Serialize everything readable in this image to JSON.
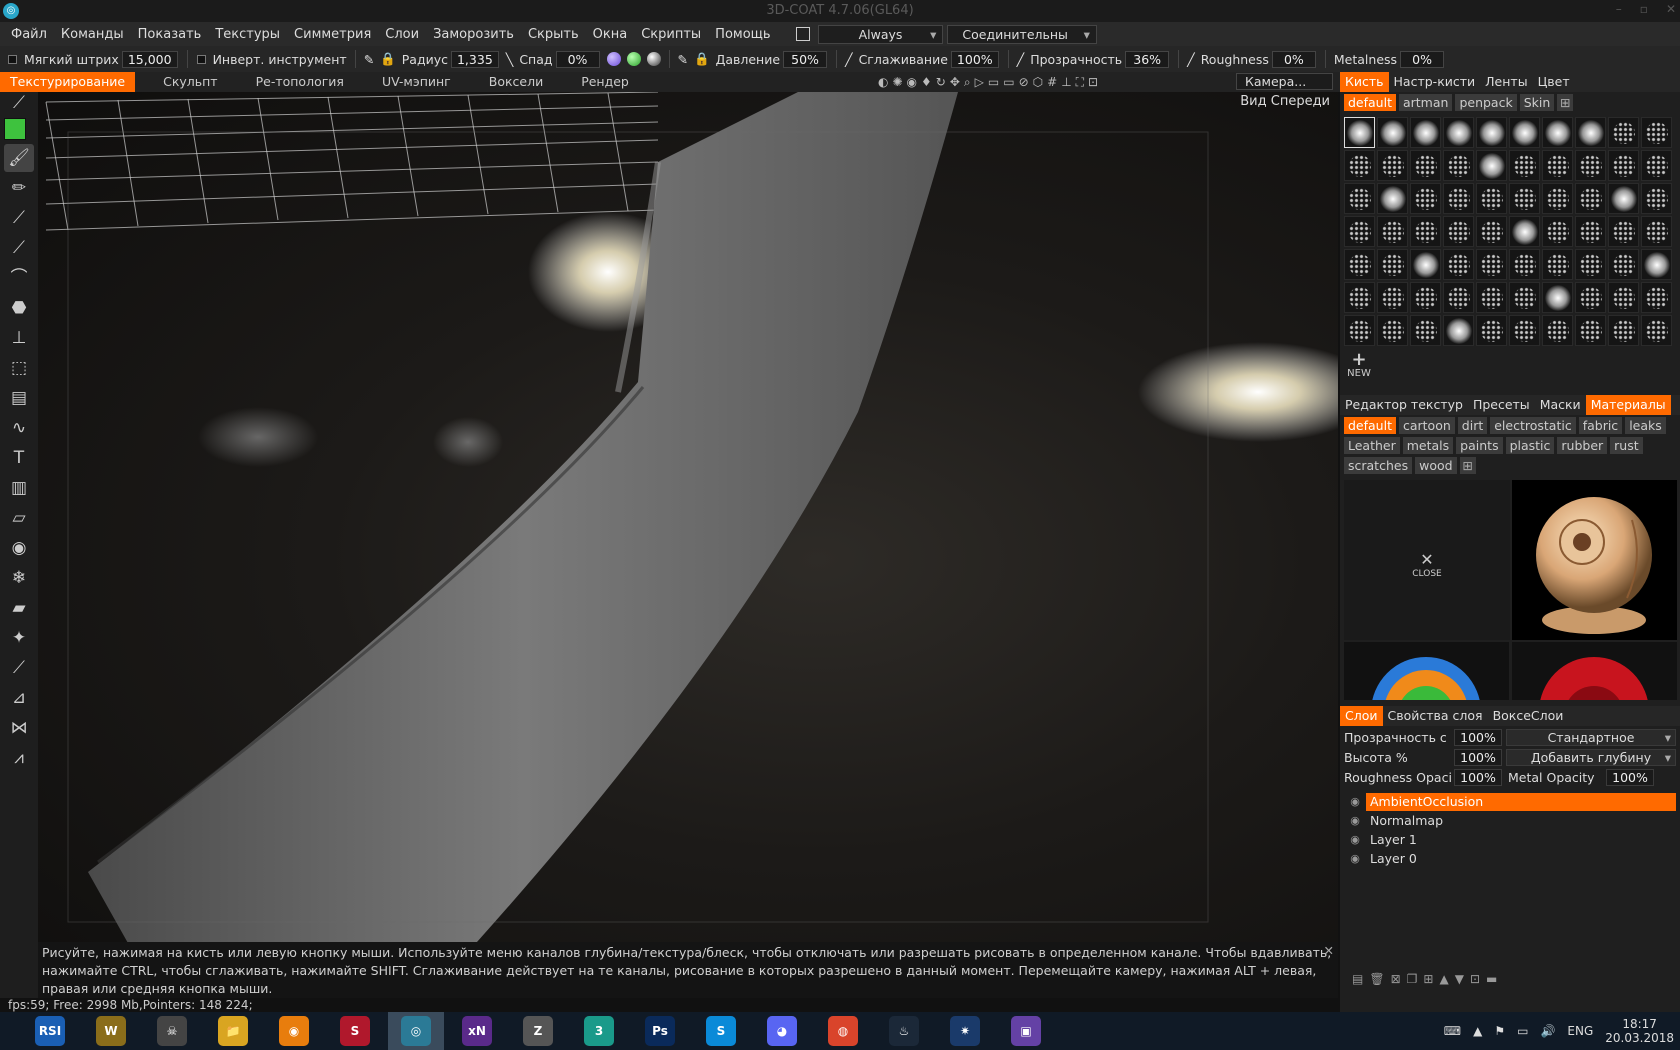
{
  "window": {
    "title": "3D-COAT 4.7.06(GL64)",
    "app_icon": "3dcoat-icon",
    "controls": [
      "–",
      "▫",
      "✕"
    ]
  },
  "menu": {
    "items": [
      "Файл",
      "Команды",
      "Показать",
      "Текстуры",
      "Симметрия",
      "Слои",
      "Заморозить",
      "Скрыть",
      "Окна",
      "Скрипты",
      "Помощь"
    ],
    "always_label": "Always",
    "connect_label": "Соединительны"
  },
  "toolbar": {
    "soft_stroke_label": "Мягкий штрих",
    "soft_stroke_value": "15,000",
    "invert_label": "Инверт. инструмент",
    "radius_label": "Радиус",
    "radius_value": "1,335",
    "falloff_label": "Спад",
    "falloff_value": "0%",
    "pressure_label": "Давление",
    "pressure_value": "50%",
    "smoothing_label": "Сглаживание",
    "smoothing_value": "100%",
    "transparency_label": "Прозрачность",
    "transparency_value": "36%",
    "roughness_label": "Roughness",
    "roughness_value": "0%",
    "metalness_label": "Metalness",
    "metalness_value": "0%"
  },
  "room_tabs": [
    "Текстурирование",
    "Скульпт",
    "Ре-топология",
    "UV-мэпинг",
    "Воксели",
    "Рендер"
  ],
  "camera_label": "Камера...",
  "viewport": {
    "view_label": "Вид Спереди"
  },
  "hint": {
    "line1": "Рисуйте, нажимая на кисть или левую кнопку мыши. Используйте меню каналов глубина/текстура/блеск, чтобы отключать или разрешать рисовать в определенном канале. Чтобы вдавливать,",
    "line2": "нажимайте CTRL, чтобы сглаживать, нажимайте SHIFT. Сглаживание действует на те каналы, рисование в которых разрешено в данный момент. Перемещайте камеру, нажимая ALT + левая,",
    "line3": "правая или средняя кнопка мыши.",
    "close": "✕"
  },
  "status": {
    "text": "fps:59;     Free: 2998 Mb,Pointers: 148 224;"
  },
  "brush_panel": {
    "tabs": [
      "Кисть",
      "Настр-кисти",
      "Ленты",
      "Цвет"
    ],
    "chips": [
      "default",
      "artman",
      "penpack",
      "Skin"
    ],
    "new_label": "NEW"
  },
  "materials_panel": {
    "tabs": [
      "Редактор текстур",
      "Пресеты",
      "Маски",
      "Материалы"
    ],
    "chips": [
      "default",
      "cartoon",
      "dirt",
      "electrostatic",
      "fabric",
      "leaks",
      "Leather",
      "metals",
      "paints",
      "plastic",
      "rubber",
      "rust",
      "scratches",
      "wood"
    ],
    "close_label": "CLOSE"
  },
  "layers_panel": {
    "tabs": [
      "Слои",
      "Свойства слоя",
      "ВоксеСлои"
    ],
    "opacity_label": "Прозрачность с",
    "opacity_value": "100%",
    "blend_mode": "Стандартное",
    "height_label": "Высота %",
    "height_value": "100%",
    "depth_mode": "Добавить глубину",
    "rough_op_label": "Roughness Opaci",
    "rough_op_value": "100%",
    "metal_op_label": "Metal Opacity",
    "metal_op_value": "100%",
    "layers": [
      "AmbientOcclusion",
      "Normalmap",
      "Layer 1",
      "Layer 0"
    ]
  },
  "taskbar": {
    "apps": [
      {
        "name": "rsi-icon",
        "label": "RSI",
        "color": "#1a5fb4"
      },
      {
        "name": "warcraft-icon",
        "label": "W",
        "color": "#8a6d1a"
      },
      {
        "name": "skull-icon",
        "label": "☠",
        "color": "#444"
      },
      {
        "name": "explorer-icon",
        "label": "📁",
        "color": "#d9a521"
      },
      {
        "name": "blender-icon",
        "label": "◉",
        "color": "#e87d0d"
      },
      {
        "name": "substance-icon",
        "label": "S",
        "color": "#b0182c"
      },
      {
        "name": "3dcoat-icon",
        "label": "◎",
        "color": "#2b7a96"
      },
      {
        "name": "xnormal-icon",
        "label": "xN",
        "color": "#5a2a8a"
      },
      {
        "name": "zbrush-icon",
        "label": "Z",
        "color": "#555"
      },
      {
        "name": "3dsmax-icon",
        "label": "3",
        "color": "#1a9a8a"
      },
      {
        "name": "photoshop-icon",
        "label": "Ps",
        "color": "#0a2a5a"
      },
      {
        "name": "skype-icon",
        "label": "S",
        "color": "#0a8ad8"
      },
      {
        "name": "discord-icon",
        "label": "◕",
        "color": "#5865f2"
      },
      {
        "name": "chrome-icon",
        "label": "◍",
        "color": "#d9442b"
      },
      {
        "name": "steam-icon",
        "label": "♨",
        "color": "#1b2838"
      },
      {
        "name": "battlenet-icon",
        "label": "✷",
        "color": "#1a3a6a"
      },
      {
        "name": "twitch-icon",
        "label": "▣",
        "color": "#6441a5"
      }
    ],
    "lang": "ENG",
    "time": "18:17",
    "date": "20.03.2018"
  }
}
